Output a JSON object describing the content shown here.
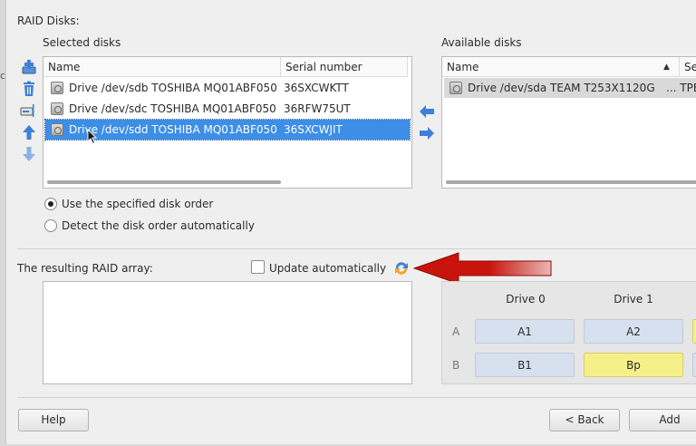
{
  "raid_disks_label": "RAID Disks:",
  "selected": {
    "label": "Selected disks",
    "columns": [
      "Name",
      "Serial number"
    ],
    "rows": [
      {
        "name": "Drive /dev/sdb TOSHIBA MQ01ABF050 ...",
        "serial": "36SXCWKTT"
      },
      {
        "name": "Drive /dev/sdc TOSHIBA MQ01ABF050 ...",
        "serial": "36RFW75UT"
      },
      {
        "name": "Drive /dev/sdd TOSHIBA MQ01ABF050 ...",
        "serial": "36SXCWJIT"
      }
    ]
  },
  "available": {
    "label": "Available disks",
    "columns": [
      "Name",
      "Se"
    ],
    "rows": [
      {
        "name": "Drive /dev/sda TEAM T253X1120G",
        "extra": "... TPE"
      }
    ]
  },
  "order": {
    "specified": "Use the specified disk order",
    "detect": "Detect the disk order automatically"
  },
  "result": {
    "label": "The resulting RAID array:",
    "update_label": "Update automatically"
  },
  "layout_grid": {
    "drives": [
      "Drive 0",
      "Drive 1"
    ],
    "rows": [
      {
        "label": "A",
        "cells": [
          {
            "text": "A1",
            "color": "blue"
          },
          {
            "text": "A2",
            "color": "blue"
          }
        ]
      },
      {
        "label": "B",
        "cells": [
          {
            "text": "B1",
            "color": "blue"
          },
          {
            "text": "Bp",
            "color": "yellow"
          }
        ]
      }
    ]
  },
  "buttons": {
    "help": "Help",
    "back": "< Back",
    "add": "Add"
  },
  "edge_glyph": "c",
  "colors": {
    "selection": "#3d8ee6",
    "arrow": "#3d7fd9",
    "parity": "#f7f08a",
    "annotation_arrow": "#c8140c"
  }
}
